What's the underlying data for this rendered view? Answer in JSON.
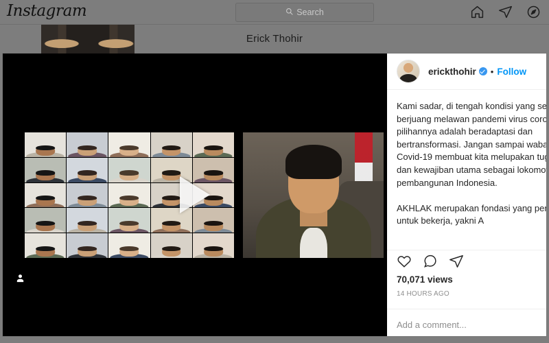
{
  "navbar": {
    "logo_text": "Instagram",
    "search": {
      "placeholder": "Search",
      "icon": "search-icon"
    },
    "icons": [
      {
        "name": "home-icon",
        "label": "Home"
      },
      {
        "name": "direct-messages-icon",
        "label": "Direct"
      },
      {
        "name": "explore-compass-icon",
        "label": "Explore"
      }
    ]
  },
  "background": {
    "profile_title": "Erick Thohir"
  },
  "post": {
    "author": {
      "username": "erickthohir",
      "verified": true,
      "separator": "•",
      "follow_label": "Follow",
      "avatar_name": "author-avatar"
    },
    "caption": "Kami sadar, di tengah kondisi yang sedang berjuang melawan pandemi virus corona, pilihannya adalah beradaptasi dan bertransformasi. Jangan sampai wabah Covid-19 membuat kita melupakan tugas dan kewajiban utama sebagai lokomotif pembangunan Indonesia.\n\nAKHLAK merupakan fondasi yang penting untuk bekerja, yakni A",
    "media": {
      "type": "video",
      "play_icon": "play-button-icon",
      "tag_icon": "tagged-people-icon",
      "grid_rows": 5,
      "grid_cols": 5
    },
    "actions": [
      {
        "name": "like-heart-icon",
        "label": "Like"
      },
      {
        "name": "comment-bubble-icon",
        "label": "Comment"
      },
      {
        "name": "share-paper-plane-icon",
        "label": "Share"
      }
    ],
    "views_text": "70,071 views",
    "timestamp": "14 HOURS AGO",
    "comment_placeholder": "Add a comment..."
  },
  "colors": {
    "accent_blue": "#0095f6",
    "verified_blue": "#3897f0",
    "overlay_gray": "#7d7d7d",
    "text_primary": "#262626",
    "text_muted": "#8e8e8e"
  }
}
